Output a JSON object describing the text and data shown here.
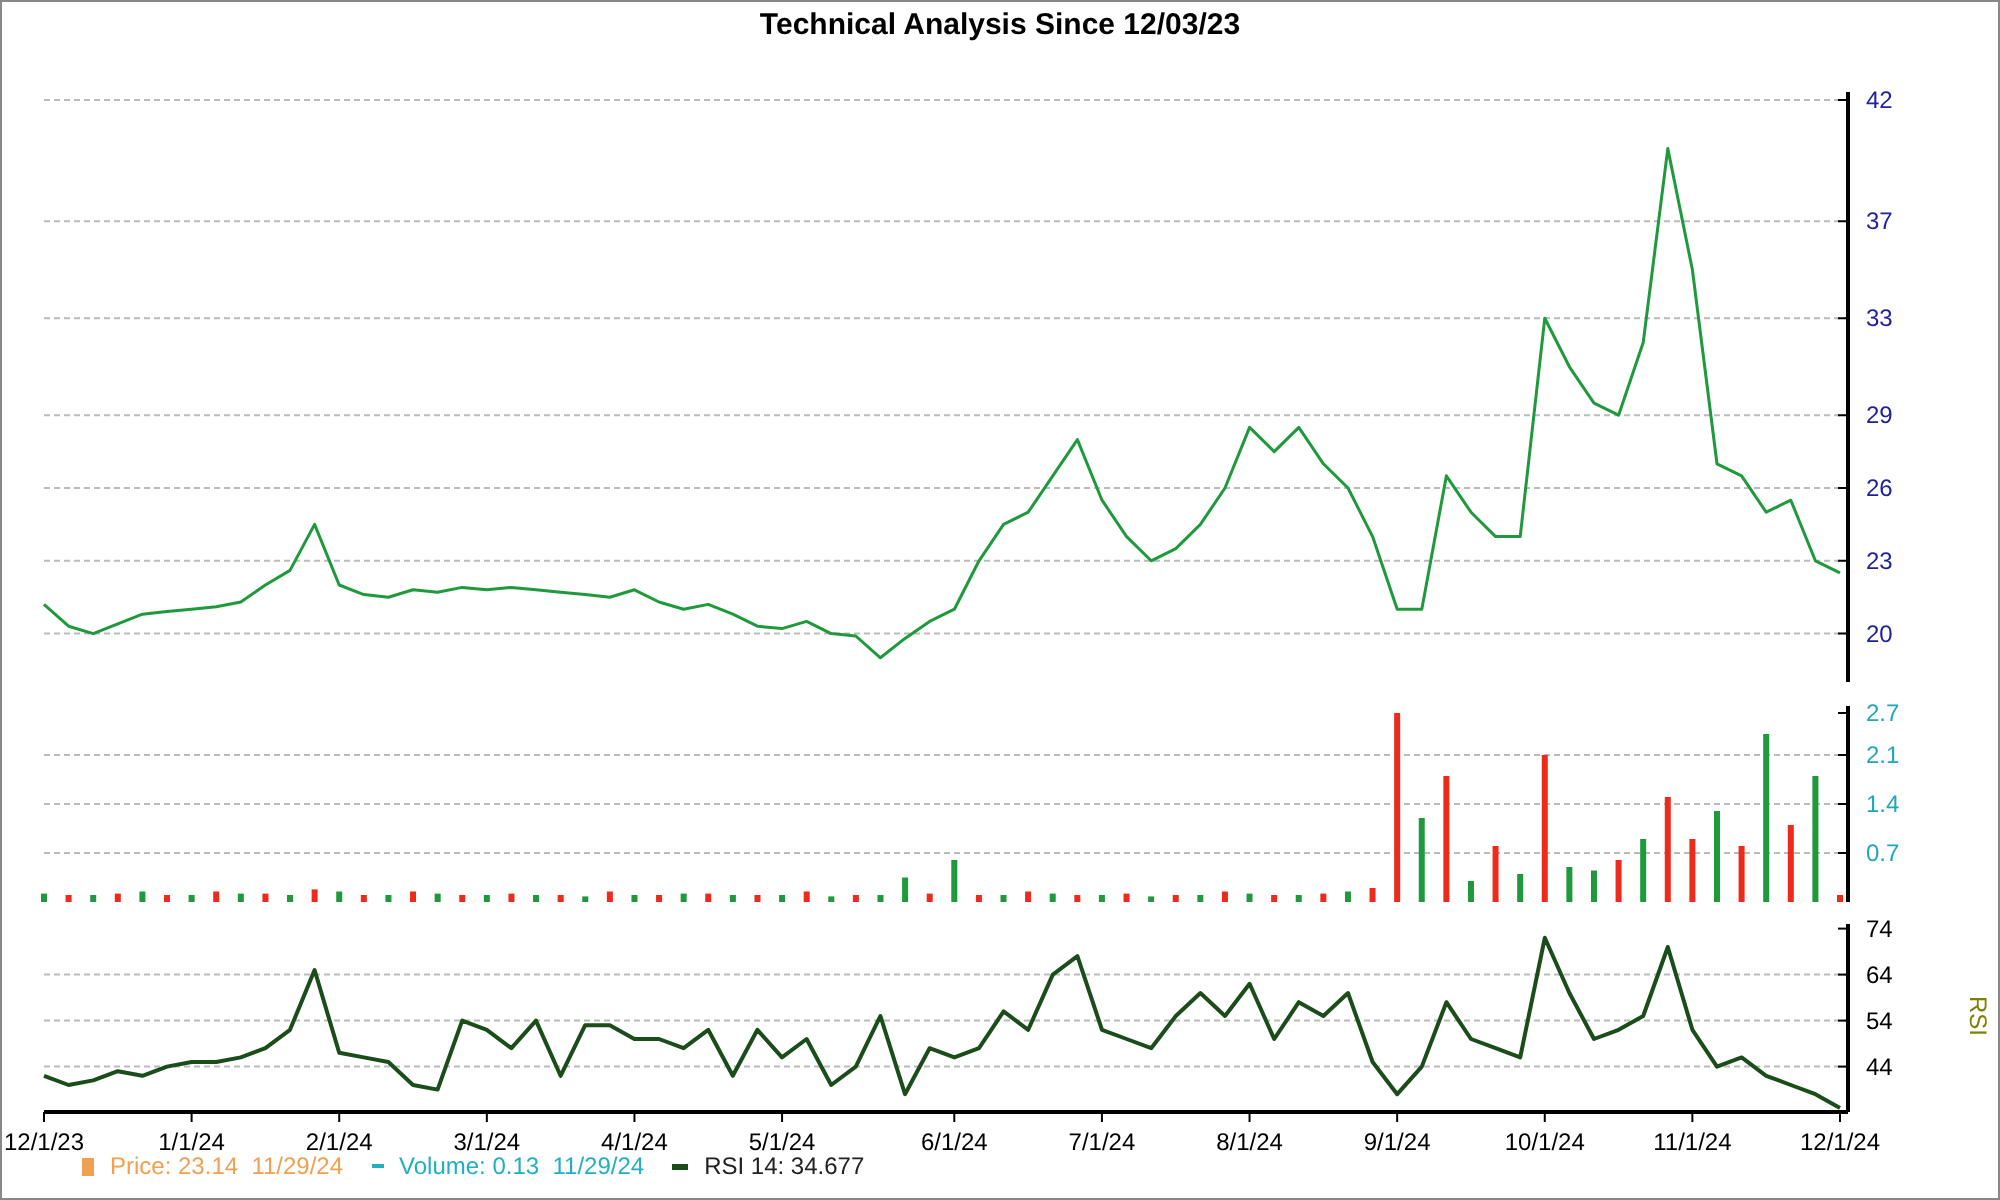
{
  "title": "Technical Analysis Since 12/03/23",
  "price_panel": {
    "chart_data": {
      "type": "line",
      "grid": true,
      "ylim": [
        18,
        42
      ],
      "yticks": [
        20,
        23,
        26,
        29,
        33,
        37,
        42
      ],
      "categories": [
        null,
        null,
        null,
        null,
        null,
        null,
        null,
        null,
        null,
        null,
        null,
        null,
        null,
        null,
        null,
        null,
        null,
        null,
        null,
        null,
        null,
        null,
        null,
        null,
        null,
        null,
        null,
        null,
        null,
        null,
        null,
        null,
        null,
        null,
        null,
        null,
        null,
        null,
        null,
        null,
        null,
        null,
        null,
        null,
        null,
        null,
        null,
        null,
        null,
        null,
        null,
        null,
        null,
        null,
        null,
        null,
        null,
        null,
        null,
        null,
        null,
        null,
        null,
        null,
        null,
        null,
        null,
        null,
        null,
        null,
        null,
        null,
        null,
        null
      ],
      "series": [
        {
          "color": "#1e9a3c",
          "values": [
            21.2,
            20.3,
            20.0,
            20.4,
            20.8,
            20.9,
            21.0,
            21.1,
            21.3,
            22.0,
            22.6,
            24.5,
            22.0,
            21.6,
            21.5,
            21.8,
            21.7,
            21.9,
            21.8,
            21.9,
            21.8,
            21.7,
            21.6,
            21.5,
            21.8,
            21.3,
            21.0,
            21.2,
            20.8,
            20.3,
            20.2,
            20.5,
            20.0,
            19.9,
            19.0,
            19.8,
            20.5,
            21.0,
            23.0,
            24.5,
            25.0,
            26.5,
            28.0,
            25.5,
            24.0,
            23.0,
            23.5,
            24.5,
            26.0,
            28.5,
            27.5,
            28.5,
            27.0,
            26.0,
            24.0,
            21.0,
            21.0,
            26.5,
            25.0,
            24.0,
            24.0,
            33.0,
            31.0,
            29.5,
            29.0,
            32.0,
            40.0,
            35.0,
            27.0,
            26.5,
            25.0,
            25.5,
            23.0,
            22.5
          ]
        }
      ]
    }
  },
  "volume_panel": {
    "chart_data": {
      "type": "bar",
      "grid": true,
      "ylim": [
        0,
        2.8
      ],
      "yticks": [
        0.7,
        1.4,
        2.1,
        2.7
      ],
      "categories": [
        null,
        null,
        null,
        null,
        null,
        null,
        null,
        null,
        null,
        null,
        null,
        null,
        null,
        null,
        null,
        null,
        null,
        null,
        null,
        null,
        null,
        null,
        null,
        null,
        null,
        null,
        null,
        null,
        null,
        null,
        null,
        null,
        null,
        null,
        null,
        null,
        null,
        null,
        null,
        null,
        null,
        null,
        null,
        null,
        null,
        null,
        null,
        null,
        null,
        null,
        null,
        null,
        null,
        null,
        null,
        null,
        null,
        null,
        null,
        null,
        null,
        null,
        null,
        null,
        null,
        null,
        null,
        null,
        null,
        null,
        null,
        null,
        null,
        null
      ],
      "series": [
        {
          "color": "#1e9a3c",
          "values": [
            0.12,
            null,
            0.1,
            null,
            0.15,
            null,
            0.1,
            null,
            0.12,
            null,
            0.1,
            null,
            0.15,
            null,
            0.1,
            null,
            0.12,
            null,
            0.1,
            null,
            0.1,
            null,
            0.08,
            null,
            0.1,
            null,
            0.12,
            null,
            0.1,
            null,
            0.1,
            null,
            0.08,
            null,
            0.1,
            0.35,
            null,
            0.6,
            null,
            0.1,
            null,
            0.12,
            null,
            0.1,
            null,
            0.08,
            null,
            0.1,
            null,
            0.12,
            null,
            0.1,
            null,
            0.15,
            null,
            null,
            1.2,
            null,
            0.3,
            null,
            0.4,
            null,
            0.5,
            0.45,
            null,
            0.9,
            null,
            null,
            1.3,
            null,
            2.4,
            null,
            1.8,
            null
          ]
        },
        {
          "color": "#ee2a1a",
          "values": [
            null,
            0.1,
            null,
            0.12,
            null,
            0.1,
            null,
            0.15,
            null,
            0.12,
            null,
            0.18,
            null,
            0.1,
            null,
            0.15,
            null,
            0.1,
            null,
            0.12,
            null,
            0.1,
            null,
            0.15,
            null,
            0.1,
            null,
            0.12,
            null,
            0.1,
            null,
            0.15,
            null,
            0.1,
            null,
            null,
            0.12,
            null,
            0.1,
            null,
            0.15,
            null,
            0.1,
            null,
            0.12,
            null,
            0.1,
            null,
            0.15,
            null,
            0.1,
            null,
            0.12,
            null,
            0.2,
            2.7,
            null,
            1.8,
            null,
            0.8,
            null,
            2.1,
            null,
            null,
            0.6,
            null,
            1.5,
            0.9,
            null,
            0.8,
            null,
            1.1,
            null,
            0.1
          ]
        }
      ]
    }
  },
  "rsi_panel": {
    "axis_title": "RSI",
    "chart_data": {
      "type": "line",
      "grid": true,
      "ylim": [
        35,
        75
      ],
      "yticks": [
        44,
        54,
        64,
        74
      ],
      "categories": [
        "12/1/23",
        null,
        null,
        null,
        null,
        null,
        "1/1/24",
        null,
        null,
        null,
        null,
        null,
        "2/1/24",
        null,
        null,
        null,
        null,
        null,
        "3/1/24",
        null,
        null,
        null,
        null,
        null,
        "4/1/24",
        null,
        null,
        null,
        null,
        null,
        "5/1/24",
        null,
        null,
        null,
        null,
        null,
        null,
        "6/1/24",
        null,
        null,
        null,
        null,
        null,
        "7/1/24",
        null,
        null,
        null,
        null,
        null,
        "8/1/24",
        null,
        null,
        null,
        null,
        null,
        "9/1/24",
        null,
        null,
        null,
        null,
        null,
        "10/1/24",
        null,
        null,
        null,
        null,
        null,
        "11/1/24",
        null,
        null,
        null,
        null,
        null,
        "12/1/24"
      ],
      "series": [
        {
          "color": "#1a4d1a",
          "values": [
            42,
            40,
            41,
            43,
            42,
            44,
            45,
            45,
            46,
            48,
            52,
            65,
            47,
            46,
            45,
            40,
            39,
            54,
            52,
            48,
            54,
            42,
            53,
            53,
            50,
            50,
            48,
            52,
            42,
            52,
            46,
            50,
            40,
            44,
            55,
            38,
            48,
            46,
            48,
            56,
            52,
            64,
            68,
            52,
            50,
            48,
            55,
            60,
            55,
            62,
            50,
            58,
            55,
            60,
            45,
            38,
            44,
            58,
            50,
            48,
            46,
            72,
            60,
            50,
            52,
            55,
            70,
            52,
            44,
            46,
            42,
            40,
            38,
            35
          ]
        }
      ]
    }
  },
  "legend": [
    {
      "kind": "square",
      "color": "#f0a050",
      "text": "Price: 23.14  11/29/24"
    },
    {
      "kind": "dash",
      "color": "#20b0c0",
      "text": "Volume: 0.13  11/29/24"
    },
    {
      "kind": "bar",
      "color": "#1a4d1a",
      "text": "RSI 14: 34.677"
    }
  ]
}
